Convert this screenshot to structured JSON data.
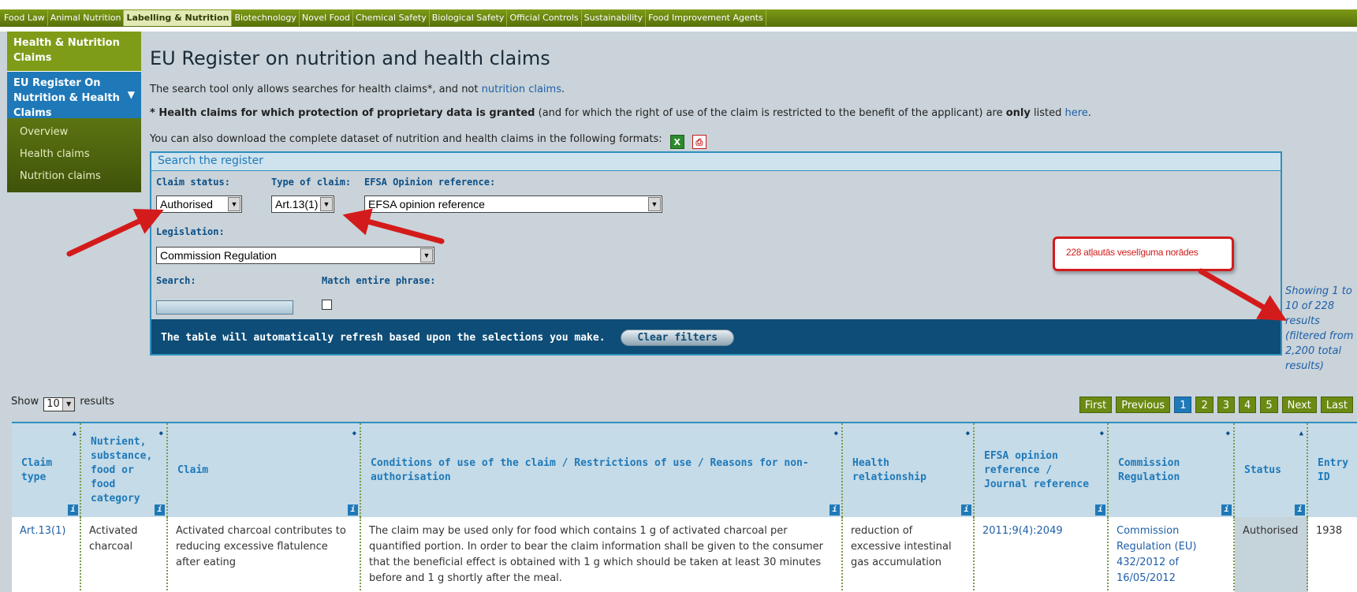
{
  "topnav": {
    "items": [
      "Food Law",
      "Animal Nutrition",
      "Labelling & Nutrition",
      "Biotechnology",
      "Novel Food",
      "Chemical Safety",
      "Biological Safety",
      "Official Controls",
      "Sustainability",
      "Food Improvement Agents"
    ],
    "active_index": 2
  },
  "sidebar": {
    "header": "Health & Nutrition Claims",
    "active": "EU Register On Nutrition & Health Claims",
    "items": [
      "Overview",
      "Health claims",
      "Nutrition claims"
    ]
  },
  "main": {
    "title": "EU Register on nutrition and health claims",
    "intro": "The search tool only allows searches for health claims*, and not ",
    "intro_link": "nutrition claims",
    "intro_end": ".",
    "note_star": "* ",
    "note_bold": "Health claims for which protection of proprietary data is granted",
    "note_mid": " (and for which the right of use of the claim is restricted to the benefit of the applicant) are ",
    "note_only": "only",
    "note_tail": " listed ",
    "note_link": "here",
    "note_end": ".",
    "download_text": "You can also download the complete dataset of nutrition and health claims in the following formats:",
    "xls_icon": "excel-icon",
    "pdf_icon": "pdf-icon"
  },
  "search": {
    "title": "Search the register",
    "claim_status_label": "Claim status:",
    "claim_status_value": "Authorised",
    "type_label": "Type of claim:",
    "type_value": "Art.13(1)",
    "efsa_label": "EFSA Opinion reference:",
    "efsa_value": "EFSA opinion reference",
    "legislation_label": "Legislation:",
    "legislation_value": "Commission Regulation",
    "search_label": "Search:",
    "match_label": "Match entire phrase:",
    "refresh_text": "The table will automatically refresh based upon the selections you make.",
    "clear_label": "Clear filters"
  },
  "annotation": {
    "callout": "228 atļautās veselīguma norādes"
  },
  "results": {
    "showing": "Showing 1 to 10 of 228 results (filtered from 2,200 total results)",
    "show_label": "Show",
    "show_value": "10",
    "show_suffix": "results"
  },
  "pager": {
    "first": "First",
    "previous": "Previous",
    "pages": [
      "1",
      "2",
      "3",
      "4",
      "5"
    ],
    "current": "1",
    "next": "Next",
    "last": "Last"
  },
  "table": {
    "headers": [
      "Claim type",
      "Nutrient, substance, food or food category",
      "Claim",
      "Conditions of use of the claim / Restrictions of use / Reasons for non-authorisation",
      "Health relationship",
      "EFSA opinion reference / Journal reference",
      "Commission Regulation",
      "Status",
      "Entry ID"
    ],
    "row": {
      "claim_type": "Art.13(1)",
      "nutrient": "Activated charcoal",
      "claim": "Activated charcoal contributes to reducing excessive flatulence after eating",
      "conditions": "The claim may be used only for food which contains 1 g of activated charcoal per quantified portion. In order to bear the claim information shall be given to the consumer that the beneficial effect is obtained with 1 g which should be taken at least 30 minutes before and 1 g shortly after the meal.",
      "health_relationship": "reduction of excessive intestinal gas accumulation",
      "efsa_ref": "2011;9(4):2049",
      "regulation": "Commission Regulation (EU) 432/2012 of 16/05/2012",
      "status": "Authorised",
      "entry_id": "1938"
    }
  },
  "colors": {
    "nav_green": "#6b8a13",
    "accent_blue": "#1f79b8",
    "dark_blue": "#0e4d77",
    "annotation_red": "#d41b1b"
  }
}
